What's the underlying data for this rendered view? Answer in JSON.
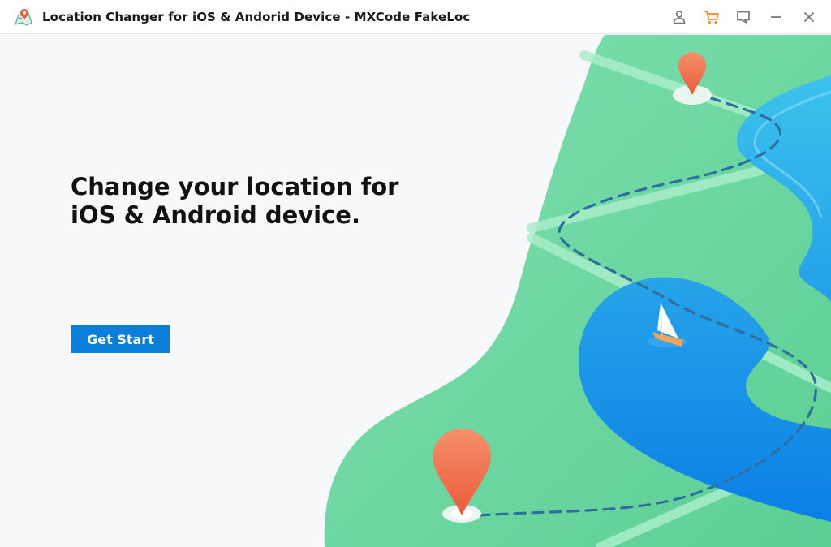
{
  "window": {
    "title": "Location Changer for iOS & Andorid Device - MXCode FakeLoc",
    "controls": [
      {
        "icon": "user-icon"
      },
      {
        "icon": "cart-icon",
        "color": "#f28a1e"
      },
      {
        "icon": "feedback-icon"
      },
      {
        "icon": "minimize-icon"
      },
      {
        "icon": "close-icon"
      }
    ]
  },
  "hero": {
    "headline_line1": "Change your location for",
    "headline_line2": "iOS & Android device."
  },
  "actions": {
    "get_start_label": "Get Start"
  },
  "colors": {
    "accent": "#0a7fd9",
    "land": "#6fd8a2",
    "river": "#1aa0ec",
    "pin": "#f2744f",
    "background": "#f7f8fa"
  }
}
